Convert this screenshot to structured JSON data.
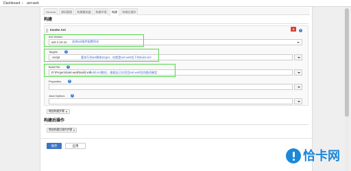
{
  "header": {
    "dashboard": "Dashboard",
    "separator": "›",
    "job": "ant-web"
  },
  "tabs": [
    {
      "label": "General"
    },
    {
      "label": "源码管理"
    },
    {
      "label": "构建触发器"
    },
    {
      "label": "构建环境"
    },
    {
      "label": "构建",
      "active": true
    },
    {
      "label": "构建后操作"
    }
  ],
  "build": {
    "title": "构建",
    "step": {
      "title": "Invoke Ant",
      "delete_label": "X",
      "ant_version": {
        "label": "Ant Version",
        "value": "ant-1.10.11"
      },
      "targets": {
        "label": "Targets",
        "value": "-script"
      },
      "build_file": {
        "label": "Build File",
        "value": "D:\\Projects\\ant-web\\build.xml"
      },
      "properties": {
        "label": "Properties"
      },
      "java_options": {
        "label": "Java Options"
      }
    },
    "add_step_label": "增加构建步骤"
  },
  "post_build": {
    "title": "构建后操作",
    "add_step_label": "增加构建后操作步骤"
  },
  "actions": {
    "save_label": "保存",
    "apply_label": "应用"
  },
  "annotations": [
    {
      "text": "选择ant插件配置的名"
    },
    {
      "text": "要执行的ant脚本target，也就是ant-web包下的build.xml"
    },
    {
      "text": "build.xml路径，根据自己在项目ant-web包的路径确定"
    }
  ],
  "watermark": {
    "brand": "恰卡网"
  },
  "icons": {
    "help": "help-icon",
    "delete": "close-icon",
    "dropdown": "chevron-down-icon",
    "grip": "drag-handle-icon",
    "logo": "exclamation-bubble-icon"
  },
  "colors": {
    "annotation_border": "#55d64b",
    "annotation_text": "#3d6fd1",
    "save_button": "#3e73c6",
    "delete_button": "#d9433a",
    "brand": "#1c88d9"
  }
}
